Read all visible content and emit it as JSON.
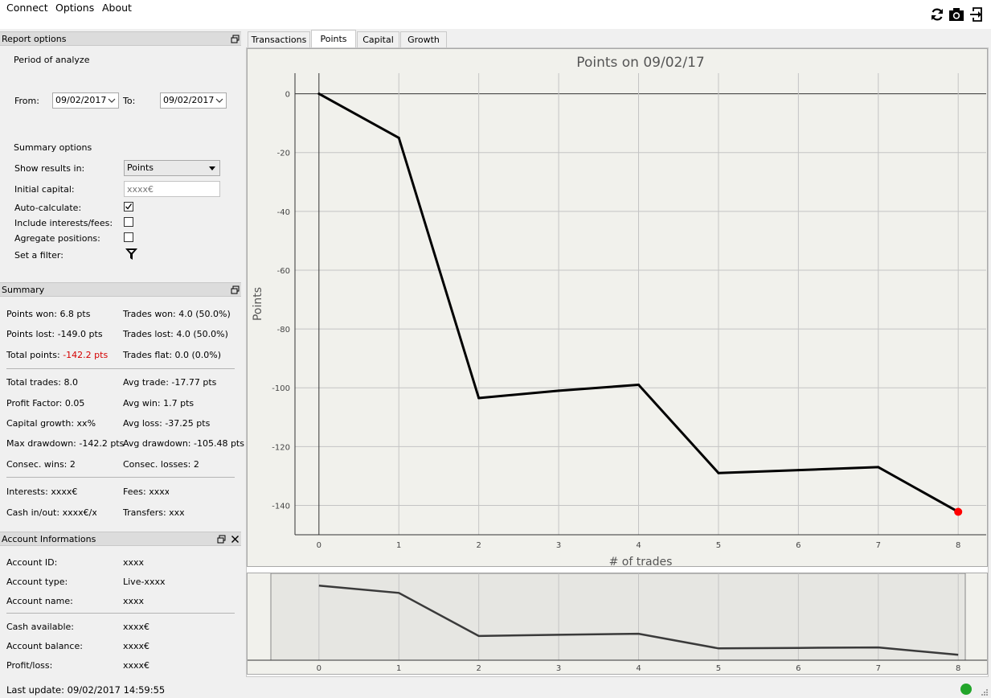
{
  "menu": {
    "connect": "Connect",
    "options": "Options",
    "about": "About"
  },
  "toolbar": {
    "icons": [
      "refresh-icon",
      "camera-icon",
      "export-icon"
    ]
  },
  "report_options": {
    "title": "Report options",
    "period_label": "Period of analyze",
    "from_label": "From:",
    "from_value": "09/02/2017",
    "to_label": "To:",
    "to_value": "09/02/2017",
    "summary_options_label": "Summary options",
    "show_results_label": "Show results in:",
    "show_results_value": "Points",
    "initial_capital_label": "Initial capital:",
    "initial_capital_placeholder": "xxxx€",
    "auto_calc_label": "Auto-calculate:",
    "auto_calc_checked": true,
    "include_fees_label": "Include interests/fees:",
    "include_fees_checked": false,
    "aggregate_label": "Agregate positions:",
    "aggregate_checked": false,
    "filter_label": "Set a filter:"
  },
  "summary": {
    "title": "Summary",
    "points_won": "Points won: 6.8 pts",
    "trades_won": "Trades won: 4.0 (50.0%)",
    "points_lost": "Points lost: -149.0 pts",
    "trades_lost": "Trades lost: 4.0 (50.0%)",
    "total_points_label": "Total points:",
    "total_points_value": "-142.2 pts",
    "trades_flat": "Trades flat: 0.0 (0.0%)",
    "total_trades": "Total trades: 8.0",
    "avg_trade": "Avg trade: -17.77 pts",
    "profit_factor": "Profit Factor: 0.05",
    "avg_win": "Avg win: 1.7 pts",
    "capital_growth": "Capital growth: xx%",
    "avg_loss": "Avg loss: -37.25 pts",
    "max_drawdown": "Max drawdown: -142.2 pts",
    "avg_drawdown": "Avg drawdown: -105.48 pts",
    "consec_wins": "Consec. wins: 2",
    "consec_losses": "Consec. losses: 2",
    "interests": "Interests: xxxx€",
    "fees": "Fees: xxxx€",
    "cash_inout": "Cash in/out: xxxx€/xxxx€",
    "transfers": "Transfers: xxxx€"
  },
  "account": {
    "title": "Account Informations",
    "id_label": "Account ID:",
    "id_value": "xxxx",
    "type_label": "Account type:",
    "type_value": "Live-xxxx",
    "name_label": "Account name:",
    "name_value": "xxxx",
    "cash_label": "Cash available:",
    "cash_value": "xxxx€",
    "balance_label": "Account balance:",
    "balance_value": "xxxx€",
    "pl_label": "Profit/loss:",
    "pl_value": "xxxx€"
  },
  "status": {
    "last_update": "Last update: 09/02/2017 14:59:55",
    "connected_color": "#22a52a"
  },
  "tabs": [
    "Transactions",
    "Points",
    "Capital",
    "Growth"
  ],
  "active_tab": "Points",
  "colors": {
    "negative": "#d40000",
    "line": "#000000",
    "last_point": "#ff0000"
  },
  "chart_data": {
    "type": "line",
    "title": "Points on 09/02/17",
    "xlabel": "# of trades",
    "ylabel": "Points",
    "x": [
      0,
      1,
      2,
      3,
      4,
      5,
      6,
      7,
      8
    ],
    "series": [
      {
        "values": [
          0,
          -15,
          -103.5,
          -101,
          -99,
          -129,
          -128,
          -127,
          -142.2
        ]
      }
    ],
    "xlim": [
      -0.3,
      8.35
    ],
    "ylim": [
      -150,
      7
    ],
    "xticks": [
      0,
      1,
      2,
      3,
      4,
      5,
      6,
      7,
      8
    ],
    "yticks": [
      0,
      -20,
      -40,
      -60,
      -80,
      -100,
      -120,
      -140
    ],
    "grid": true,
    "overview_x_ticks": [
      0,
      1,
      2,
      3,
      4,
      5,
      6,
      7,
      8
    ]
  }
}
